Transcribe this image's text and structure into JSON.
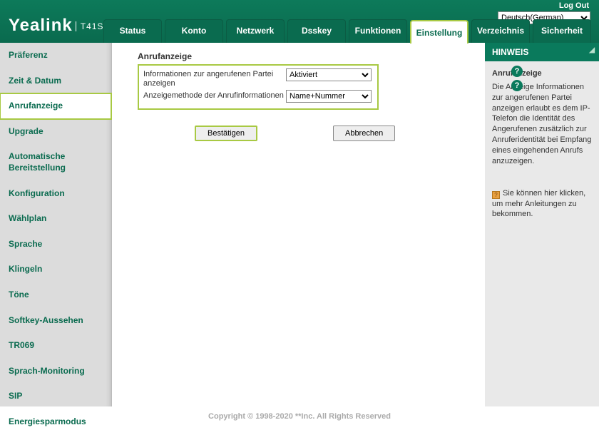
{
  "header": {
    "logout": "Log Out",
    "language_selected": "Deutsch(German)",
    "logo": "Yealink",
    "model": "T41S"
  },
  "tabs": [
    {
      "label": "Status"
    },
    {
      "label": "Konto"
    },
    {
      "label": "Netzwerk"
    },
    {
      "label": "Dsskey"
    },
    {
      "label": "Funktionen"
    },
    {
      "label": "Einstellung",
      "active": true
    },
    {
      "label": "Verzeichnis"
    },
    {
      "label": "Sicherheit"
    }
  ],
  "sidebar": [
    {
      "label": "Präferenz"
    },
    {
      "label": "Zeit & Datum"
    },
    {
      "label": "Anrufanzeige",
      "active": true
    },
    {
      "label": "Upgrade"
    },
    {
      "label": "Automatische Bereitstellung"
    },
    {
      "label": "Konfiguration"
    },
    {
      "label": "Wählplan"
    },
    {
      "label": "Sprache"
    },
    {
      "label": "Klingeln"
    },
    {
      "label": "Töne"
    },
    {
      "label": "Softkey-Aussehen"
    },
    {
      "label": "TR069"
    },
    {
      "label": "Sprach-Monitoring"
    },
    {
      "label": "SIP"
    },
    {
      "label": "Energiesparmodus"
    }
  ],
  "form": {
    "section_title": "Anrufanzeige",
    "row1_label": "Informationen zur angerufenen Partei anzeigen",
    "row1_value": "Aktiviert",
    "row2_label": "Anzeigemethode der Anrufinformationen",
    "row2_value": "Name+Nummer",
    "confirm": "Bestätigen",
    "cancel": "Abbrechen"
  },
  "hint": {
    "header": "HINWEIS",
    "title": "Anrufanzeige",
    "text": "Die Anzeige Informationen zur angerufenen Partei anzeigen erlaubt es dem IP-Telefon die Identität des Angerufenen zusätzlich zur Anruferidentität bei Empfang eines eingehenden Anrufs anzuzeigen.",
    "link": "Sie können hier klicken, um mehr Anleitungen zu bekommen."
  },
  "footer": "Copyright © 1998-2020 **Inc. All Rights Reserved"
}
